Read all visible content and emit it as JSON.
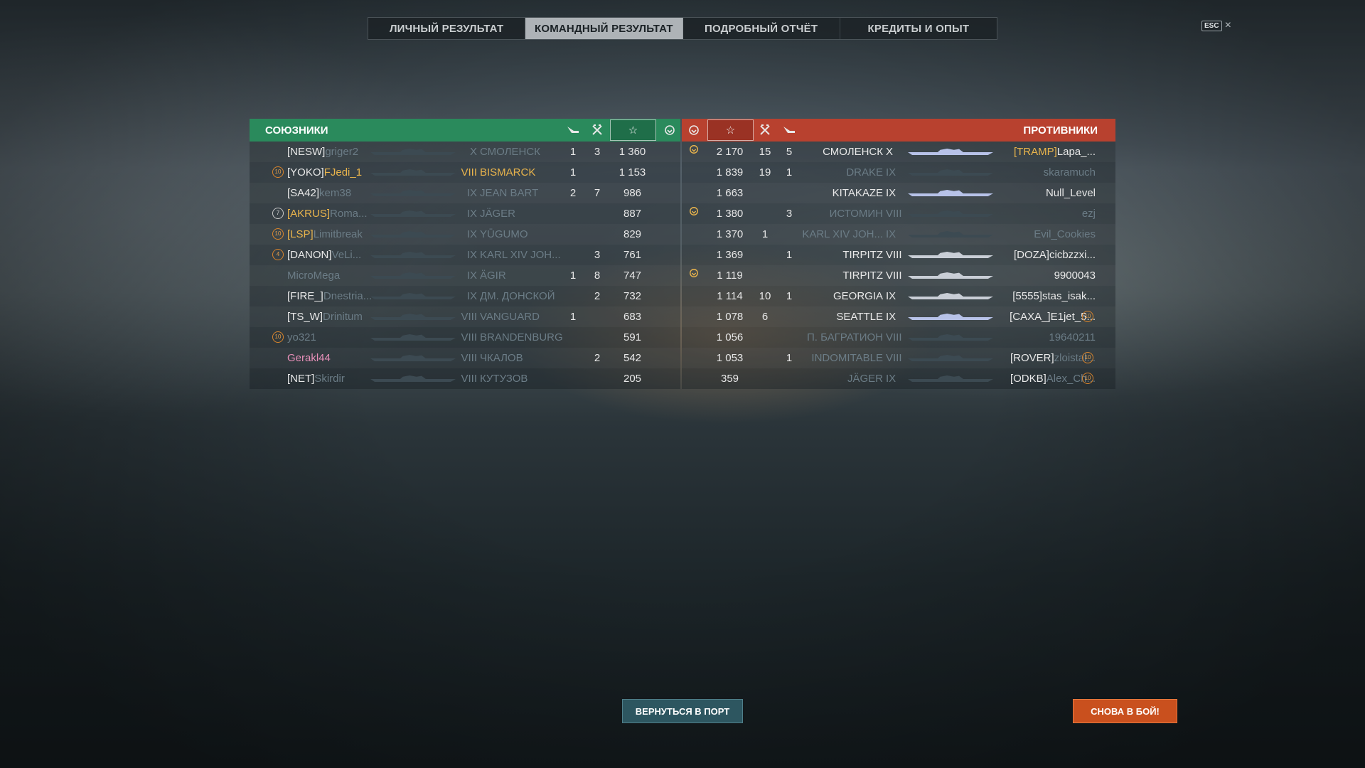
{
  "tabs": [
    {
      "label": "ЛИЧНЫЙ РЕЗУЛЬТАТ",
      "active": false
    },
    {
      "label": "КОМАНДНЫЙ РЕЗУЛЬТАТ",
      "active": true
    },
    {
      "label": "ПОДРОБНЫЙ ОТЧЁТ",
      "active": false
    },
    {
      "label": "КРЕДИТЫ И ОПЫТ",
      "active": false
    }
  ],
  "esc": {
    "key": "ESC",
    "close": "×"
  },
  "allies": {
    "title": "СОЮЗНИКИ",
    "color": "#2a8a5c",
    "icons": [
      "plane-icon",
      "ship-kill-icon",
      "star-icon",
      "laurel-icon"
    ],
    "rows": [
      {
        "badge": "",
        "clan": "[NESW]",
        "name": "griger2",
        "name_style": "dim",
        "tier": "X",
        "ship": "СМОЛЕНСК",
        "ship_style": "dim",
        "planes": "1",
        "kills": "3",
        "xp": "1 360"
      },
      {
        "badge": "10",
        "clan": "[YOKO]",
        "name": "FJedi_1",
        "name_style": "gold",
        "tier": "VIII",
        "ship": "BISMARCK",
        "ship_style": "gold",
        "planes": "1",
        "kills": "",
        "xp": "1 153"
      },
      {
        "badge": "",
        "clan": "[SA42]",
        "name": "kem38",
        "name_style": "dim",
        "tier": "IX",
        "ship": "JEAN BART",
        "ship_style": "dim",
        "planes": "2",
        "kills": "7",
        "xp": "986"
      },
      {
        "badge": "7",
        "clan": "[AKRUS]",
        "name": "Roma...",
        "name_style": "dim",
        "tier": "IX",
        "ship": "JÄGER",
        "ship_style": "dim",
        "planes": "",
        "kills": "",
        "xp": "887"
      },
      {
        "badge": "10",
        "clan": "[LSP]",
        "name": "Limitbreak",
        "name_style": "dim",
        "tier": "IX",
        "ship": "YŪGUMO",
        "ship_style": "dim",
        "planes": "",
        "kills": "",
        "xp": "829"
      },
      {
        "badge": "4",
        "clan": "[DANON]",
        "name": "VeLi...",
        "name_style": "dim",
        "tier": "IX",
        "ship": "KARL XIV JOH...",
        "ship_style": "dim",
        "planes": "",
        "kills": "3",
        "xp": "761"
      },
      {
        "badge": "",
        "clan": "",
        "name": "MicroMega",
        "name_style": "dim",
        "tier": "IX",
        "ship": "ÄGIR",
        "ship_style": "dim",
        "planes": "1",
        "kills": "8",
        "xp": "747"
      },
      {
        "badge": "",
        "clan": "[FIRE_]",
        "name": "Dnestria...",
        "name_style": "dim",
        "tier": "IX",
        "ship": "ДМ. ДОНСКОЙ",
        "ship_style": "dim",
        "planes": "",
        "kills": "2",
        "xp": "732"
      },
      {
        "badge": "",
        "clan": "[TS_W]",
        "name": "Drinitum",
        "name_style": "dim",
        "tier": "VIII",
        "ship": "VANGUARD",
        "ship_style": "dim",
        "planes": "1",
        "kills": "",
        "xp": "683"
      },
      {
        "badge": "10",
        "clan": "",
        "name": "yo321",
        "name_style": "dim",
        "tier": "VIII",
        "ship": "BRANDENBURG",
        "ship_style": "dim",
        "planes": "",
        "kills": "",
        "xp": "591"
      },
      {
        "badge": "",
        "clan": "",
        "name": "Gerakl44",
        "name_style": "pink",
        "tier": "VIII",
        "ship": "ЧКАЛОВ",
        "ship_style": "dim",
        "planes": "",
        "kills": "2",
        "xp": "542"
      },
      {
        "badge": "",
        "clan": "[NET]",
        "name": "Skirdir",
        "name_style": "dim",
        "tier": "VIII",
        "ship": "КУТУЗОВ",
        "ship_style": "dim",
        "planes": "",
        "kills": "",
        "xp": "205"
      }
    ]
  },
  "enemies": {
    "title": "ПРОТИВНИКИ",
    "color": "#b8412f",
    "icons": [
      "laurel-icon",
      "star-icon",
      "ship-kill-icon",
      "plane-icon"
    ],
    "rows": [
      {
        "laurel": true,
        "xp": "2 170",
        "kills": "15",
        "planes": "5",
        "ship": "СМОЛЕНСК",
        "ship_style": "white",
        "tier": "X",
        "clan": "[TRAMP]",
        "clan_style": "gold",
        "name": "Lapa_...",
        "name_style": "white",
        "badge": ""
      },
      {
        "laurel": false,
        "xp": "1 839",
        "kills": "19",
        "planes": "1",
        "ship": "DRAKE",
        "ship_style": "dim",
        "tier": "IX",
        "clan": "",
        "clan_style": "white",
        "name": "skaramuch",
        "name_style": "dim",
        "badge": ""
      },
      {
        "laurel": false,
        "xp": "1 663",
        "kills": "",
        "planes": "",
        "ship": "KITAKAZE",
        "ship_style": "white",
        "tier": "IX",
        "clan": "",
        "clan_style": "white",
        "name": "Null_Level",
        "name_style": "white",
        "badge": ""
      },
      {
        "laurel": true,
        "xp": "1 380",
        "kills": "",
        "planes": "3",
        "ship": "ИСТОМИН",
        "ship_style": "dim",
        "tier": "VIII",
        "clan": "",
        "clan_style": "white",
        "name": "ezj",
        "name_style": "dim",
        "badge": ""
      },
      {
        "laurel": false,
        "xp": "1 370",
        "kills": "1",
        "planes": "",
        "ship": "KARL XIV JOH...",
        "ship_style": "dim",
        "tier": "IX",
        "clan": "",
        "clan_style": "white",
        "name": "Evil_Cookies",
        "name_style": "dim",
        "badge": ""
      },
      {
        "laurel": false,
        "xp": "1 369",
        "kills": "",
        "planes": "1",
        "ship": "TIRPITZ",
        "ship_style": "white",
        "tier": "VIII",
        "clan": "[DOZA]",
        "clan_style": "white",
        "name": "cicbzzxi...",
        "name_style": "white",
        "badge": ""
      },
      {
        "laurel": true,
        "xp": "1 119",
        "kills": "",
        "planes": "",
        "ship": "TIRPITZ",
        "ship_style": "white",
        "tier": "VIII",
        "clan": "",
        "clan_style": "white",
        "name": "9900043",
        "name_style": "white",
        "badge": ""
      },
      {
        "laurel": false,
        "xp": "1 114",
        "kills": "10",
        "planes": "1",
        "ship": "GEORGIA",
        "ship_style": "white",
        "tier": "IX",
        "clan": "[5555]",
        "clan_style": "white",
        "name": "stas_isak...",
        "name_style": "white",
        "badge": ""
      },
      {
        "laurel": false,
        "xp": "1 078",
        "kills": "6",
        "planes": "",
        "ship": "SEATTLE",
        "ship_style": "white",
        "tier": "IX",
        "clan": "[CAXA_]",
        "clan_style": "white",
        "name": "E1jet_5...",
        "name_style": "white",
        "badge": "10"
      },
      {
        "laurel": false,
        "xp": "1 056",
        "kills": "",
        "planes": "",
        "ship": "П. БАГРАТИОН",
        "ship_style": "dim",
        "tier": "VIII",
        "clan": "",
        "clan_style": "white",
        "name": "19640211",
        "name_style": "dim",
        "badge": ""
      },
      {
        "laurel": false,
        "xp": "1 053",
        "kills": "",
        "planes": "1",
        "ship": "INDOMITABLE",
        "ship_style": "dim",
        "tier": "VIII",
        "clan": "[ROVER]",
        "clan_style": "white",
        "name": "zloistal...",
        "name_style": "dim",
        "badge": "10"
      },
      {
        "laurel": false,
        "xp": "359",
        "kills": "",
        "planes": "",
        "ship": "JÄGER",
        "ship_style": "dim",
        "tier": "IX",
        "clan": "[ODKB]",
        "clan_style": "white",
        "name": "Alex_Ch...",
        "name_style": "dim",
        "badge": "10"
      }
    ]
  },
  "buttons": {
    "port": "ВЕРНУТЬСЯ В ПОРТ",
    "battle": "СНОВА В БОЙ!"
  }
}
